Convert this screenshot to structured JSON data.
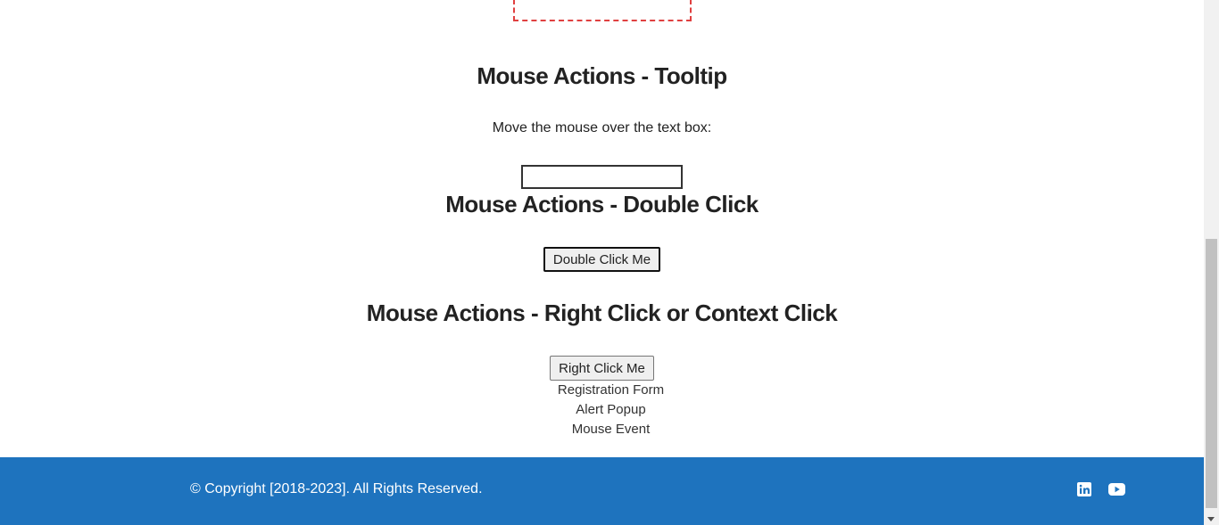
{
  "tooltip_section": {
    "title": "Mouse Actions - Tooltip",
    "instruction": "Move the mouse over the text box:",
    "textbox_value": ""
  },
  "double_click_section": {
    "title": "Mouse Actions - Double Click",
    "button_label": "Double Click Me"
  },
  "right_click_section": {
    "title": "Mouse Actions - Right Click or Context Click",
    "button_label": "Right Click Me",
    "menu_items": [
      "Registration Form",
      "Alert Popup",
      "Mouse Event"
    ]
  },
  "footer": {
    "copyright": "© Copyright [2018-2023]. All Rights Reserved.",
    "background_color": "#1e73be",
    "social_icons": [
      "linkedin-icon",
      "youtube-icon"
    ]
  }
}
